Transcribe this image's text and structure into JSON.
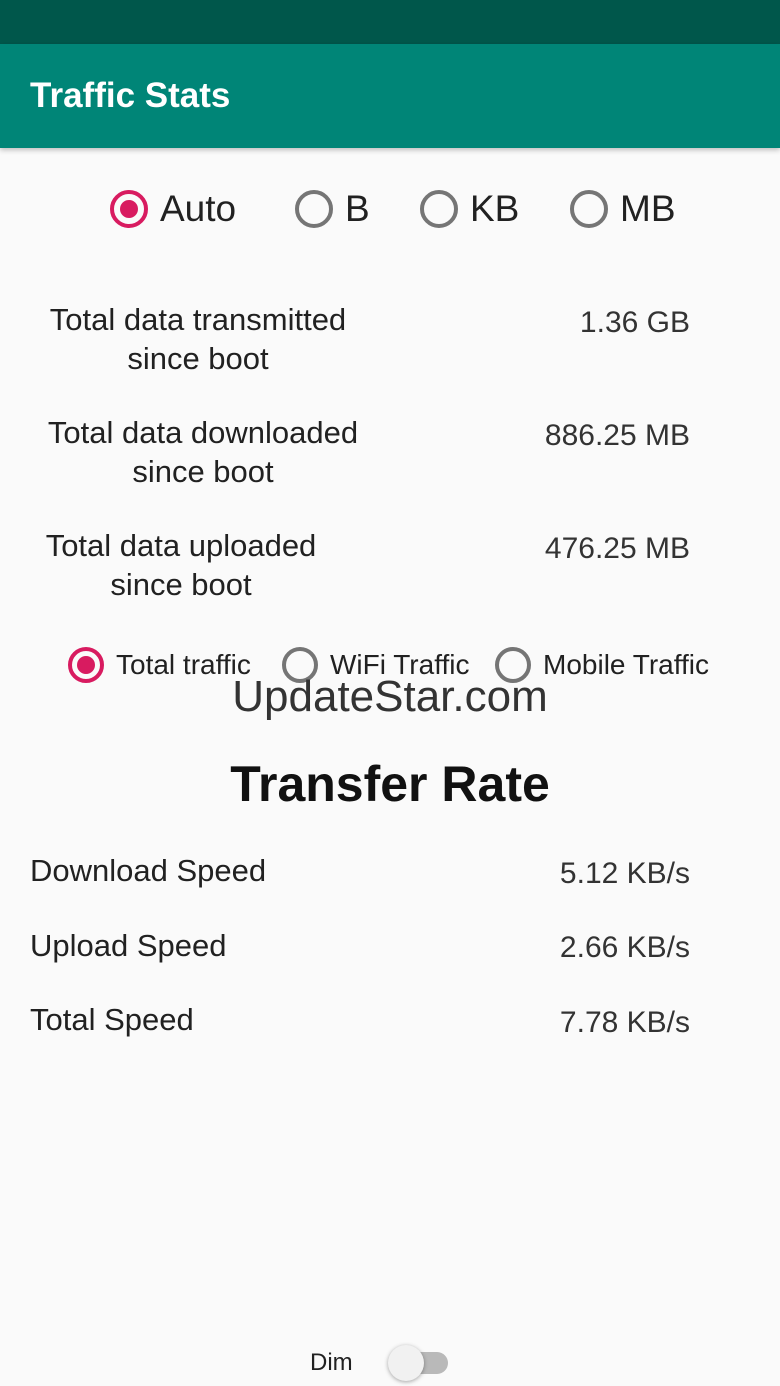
{
  "app": {
    "title": "Traffic Stats"
  },
  "units": {
    "options": [
      {
        "label": "Auto",
        "checked": true
      },
      {
        "label": "B",
        "checked": false
      },
      {
        "label": "KB",
        "checked": false
      },
      {
        "label": "MB",
        "checked": false
      }
    ]
  },
  "totals": [
    {
      "line1": "Total data transmitted",
      "line2": "since boot",
      "value": "1.36 GB"
    },
    {
      "line1": "Total data downloaded",
      "line2": "since boot",
      "value": "886.25 MB"
    },
    {
      "line1": "Total data uploaded",
      "line2": "since boot",
      "value": "476.25 MB"
    }
  ],
  "traffic_type": {
    "options": [
      {
        "label": "Total traffic",
        "checked": true
      },
      {
        "label": "WiFi Traffic",
        "checked": false
      },
      {
        "label": "Mobile Traffic",
        "checked": false
      }
    ]
  },
  "watermark": "UpdateStar.com",
  "transfer": {
    "title": "Transfer Rate",
    "rows": [
      {
        "label": "Download Speed",
        "value": "5.12 KB/s"
      },
      {
        "label": "Upload Speed",
        "value": "2.66 KB/s"
      },
      {
        "label": "Total Speed",
        "value": "7.78 KB/s"
      }
    ]
  },
  "dim": {
    "label": "Dim",
    "enabled": false
  },
  "colors": {
    "status_bar": "#00574b",
    "app_bar": "#008577",
    "accent": "#d81b60",
    "background": "#fafafa"
  }
}
